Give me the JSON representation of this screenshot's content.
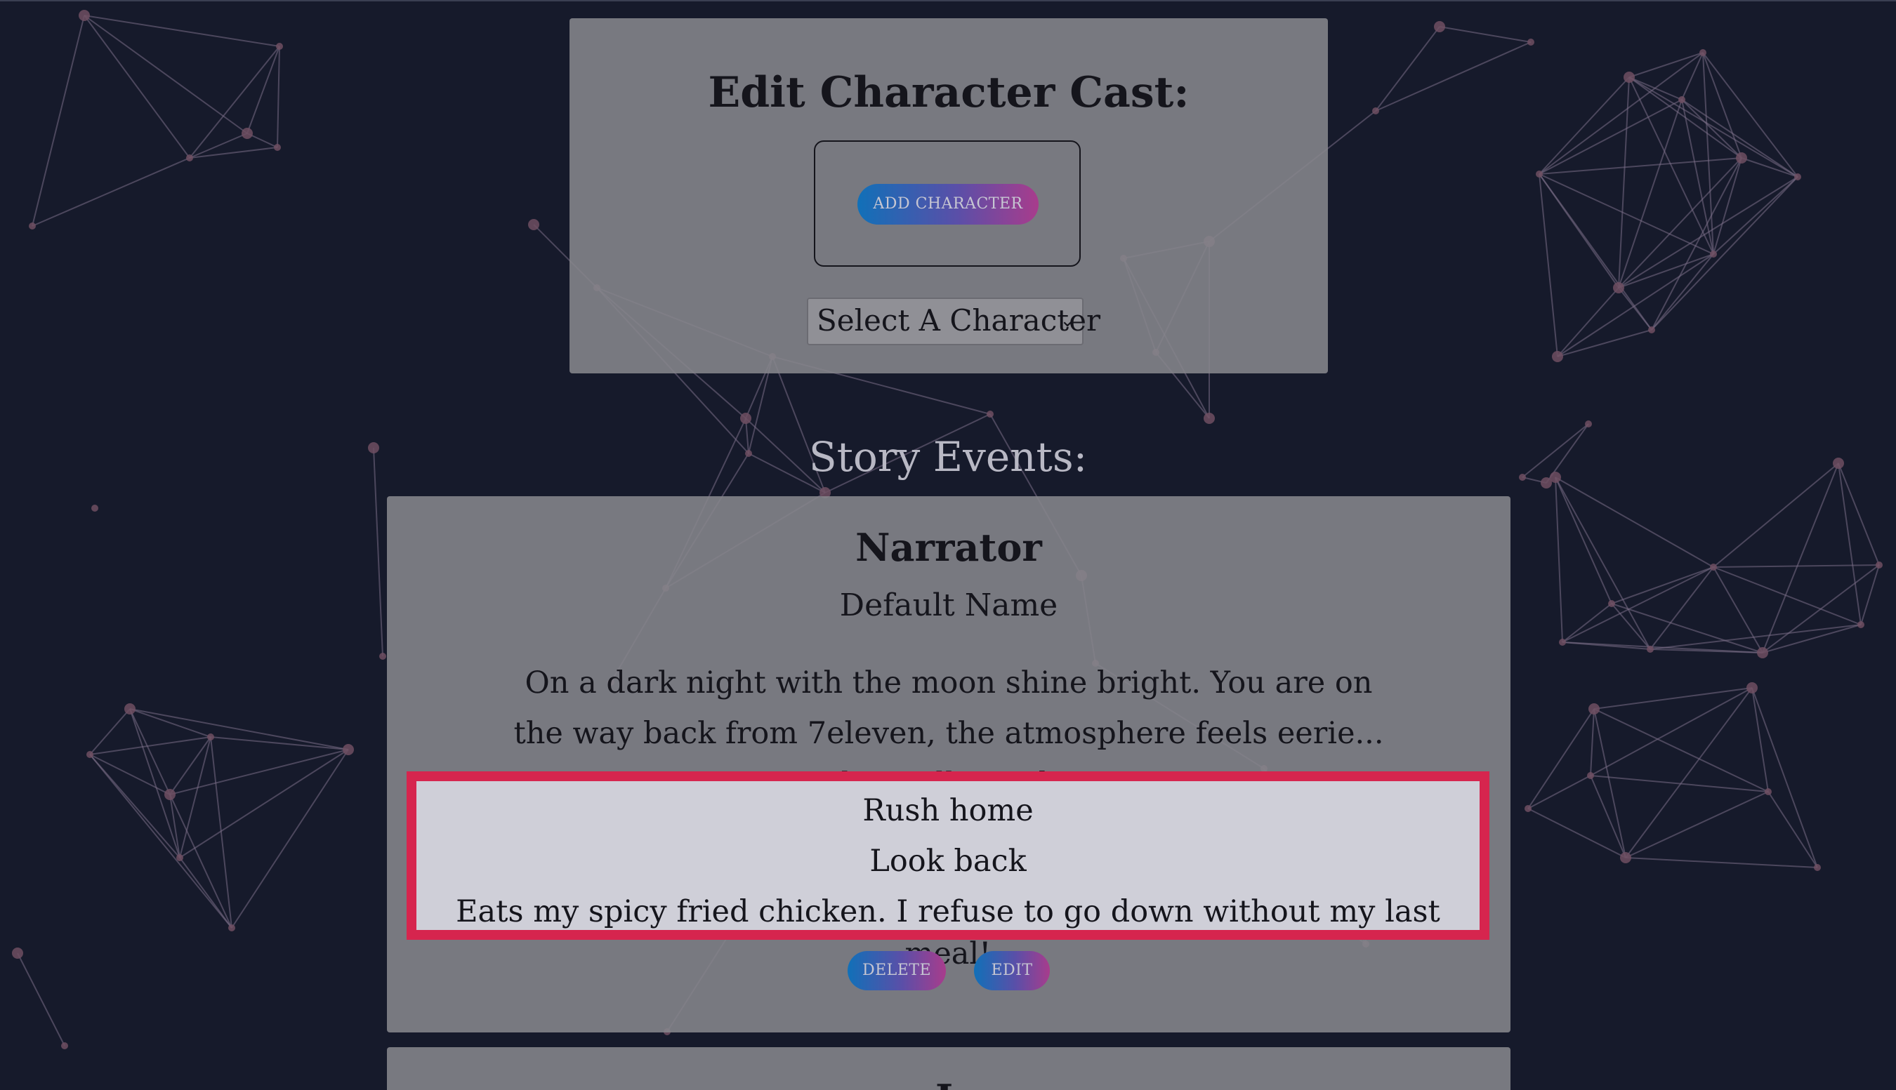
{
  "cast": {
    "title": "Edit Character Cast:",
    "add_button": "ADD CHARACTER",
    "select_value": "Select A Character",
    "select_chevron": "⌄"
  },
  "events": {
    "heading": "Story Events:",
    "items": [
      {
        "speaker": "Narrator",
        "name": "Default Name",
        "text": "On a dark night with the moon shine bright. You are on the way back from 7eleven, the atmosphere feels eerie... what will you do?",
        "choices": [
          "Rush home",
          "Look back",
          "Eats my spicy fried chicken. I refuse to go down without my last meal!"
        ],
        "delete_label": "DELETE",
        "edit_label": "EDIT"
      },
      {
        "speaker": "L"
      }
    ]
  },
  "colors": {
    "background": "#161a2b",
    "panel": "#86868c",
    "highlight_border": "#d6254e",
    "button_gradient_start": "#1170b8",
    "button_gradient_end": "#a83c8c"
  }
}
